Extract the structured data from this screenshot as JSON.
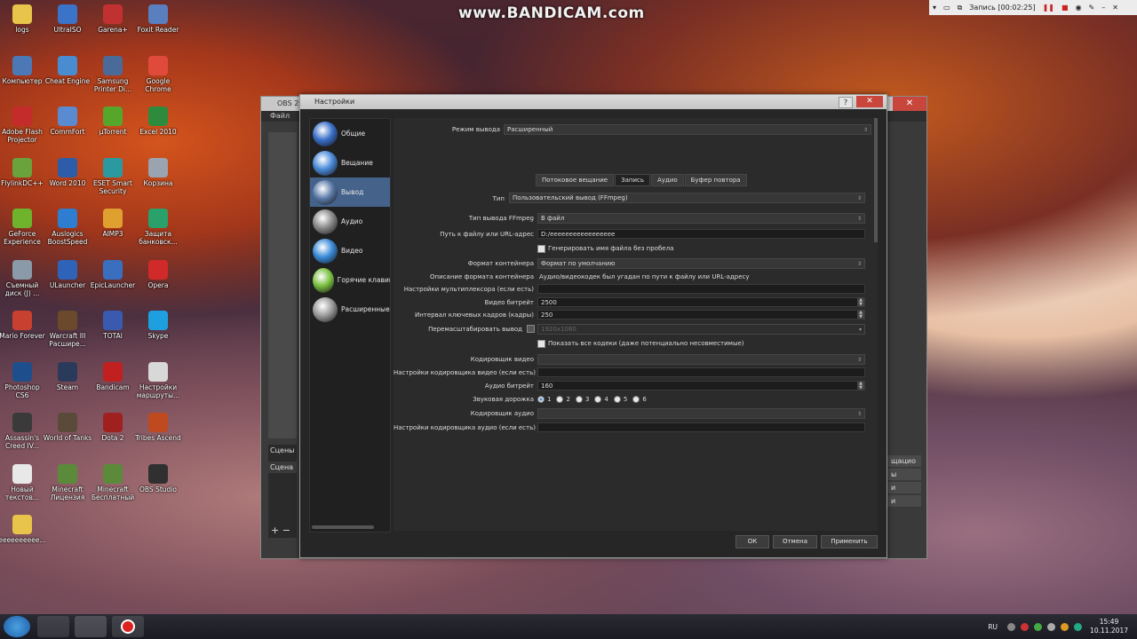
{
  "watermark": "www.BANDICAM.com",
  "recorder_bar": {
    "status": "Запись [00:02:25]"
  },
  "desktop_icons": [
    {
      "label": "logs",
      "color": "#e8c44a"
    },
    {
      "label": "UltraISO",
      "color": "#3a73c8"
    },
    {
      "label": "Garena+",
      "color": "#c23131"
    },
    {
      "label": "Foxit Reader",
      "color": "#5a7fbf"
    },
    {
      "label": "Компьютер",
      "color": "#4c79b5"
    },
    {
      "label": "Cheat Engine",
      "color": "#4a8cd0"
    },
    {
      "label": "Samsung Printer Di...",
      "color": "#4a6a9a"
    },
    {
      "label": "Google Chrome",
      "color": "#e04a3a"
    },
    {
      "label": "Adobe Flash Projector",
      "color": "#c42b2b"
    },
    {
      "label": "CommFort",
      "color": "#5a8ad0"
    },
    {
      "label": "µTorrent",
      "color": "#56a62c"
    },
    {
      "label": "Excel 2010",
      "color": "#2e8b3e"
    },
    {
      "label": "FlylinkDC++",
      "color": "#6aa23c"
    },
    {
      "label": "Word 2010",
      "color": "#2d5da8"
    },
    {
      "label": "ESET Smart Security",
      "color": "#2a9aa0"
    },
    {
      "label": "Корзина",
      "color": "#9aa4b0"
    },
    {
      "label": "GeForce Experience",
      "color": "#6fb32c"
    },
    {
      "label": "Auslogics BoostSpeed",
      "color": "#2f7dd0"
    },
    {
      "label": "AIMP3",
      "color": "#e0a030"
    },
    {
      "label": "Защита банковск...",
      "color": "#2aa06a"
    },
    {
      "label": "Съемный диск (J) ...",
      "color": "#8a9aa8"
    },
    {
      "label": "ULauncher",
      "color": "#2f63b8"
    },
    {
      "label": "EpicLauncher",
      "color": "#3a6fc0"
    },
    {
      "label": "Opera",
      "color": "#d02a2a"
    },
    {
      "label": "Mario Forever",
      "color": "#c84030"
    },
    {
      "label": "Warcraft III Расшире...",
      "color": "#6a4a2a"
    },
    {
      "label": "TOTAl",
      "color": "#3a5ab0"
    },
    {
      "label": "Skype",
      "color": "#1ea0e0"
    },
    {
      "label": "Photoshop CS6",
      "color": "#1e4f8c"
    },
    {
      "label": "Steam",
      "color": "#2a3a5a"
    },
    {
      "label": "Bandicam",
      "color": "#c02020"
    },
    {
      "label": "Настройки маршруты...",
      "color": "#d8d8d8"
    },
    {
      "label": "Assassin's Creed IV...",
      "color": "#3a3a3a"
    },
    {
      "label": "World of Tanks",
      "color": "#5a4a3a"
    },
    {
      "label": "Dota 2",
      "color": "#a02020"
    },
    {
      "label": "Tribes Ascend",
      "color": "#c04a20"
    },
    {
      "label": "Новый текстов...",
      "color": "#e8e8e8"
    },
    {
      "label": "Minecraft Лицензия",
      "color": "#5a8a3a"
    },
    {
      "label": "Minecraft Бесплатный",
      "color": "#5a8a3a"
    },
    {
      "label": "OBS Studio",
      "color": "#303030"
    },
    {
      "label": "eeeeeeeeee...",
      "color": "#e8c44a"
    }
  ],
  "obs_window": {
    "title": "OBS 20",
    "menu_file": "Файл",
    "scenes_label": "Сцены",
    "scene_item": "Сцена",
    "right_items": [
      "щацио",
      "ы",
      "и",
      "и"
    ]
  },
  "dialog": {
    "title": "Настройки",
    "help_btn": "?",
    "close_btn": "✕",
    "sidebar": [
      {
        "label": "Общие",
        "active": false,
        "color": "#3a6fc8"
      },
      {
        "label": "Вещание",
        "active": false,
        "color": "#4a8ad8"
      },
      {
        "label": "Вывод",
        "active": true,
        "color": "#5a7aa8"
      },
      {
        "label": "Аудио",
        "active": false,
        "color": "#8a8a8a"
      },
      {
        "label": "Видео",
        "active": false,
        "color": "#3a8ad8"
      },
      {
        "label": "Горячие клавиши",
        "active": false,
        "color": "#7ac040"
      },
      {
        "label": "Расширенные",
        "active": false,
        "color": "#9a9a9a"
      }
    ],
    "output_mode_label": "Режим вывода",
    "output_mode_value": "Расширенный",
    "tabs": [
      {
        "label": "Потоковое вещание",
        "active": false
      },
      {
        "label": "Запись",
        "active": true
      },
      {
        "label": "Аудио",
        "active": false
      },
      {
        "label": "Буфер повтора",
        "active": false
      }
    ],
    "type_label": "Тип",
    "type_value": "Пользовательский вывод (FFmpeg)",
    "ffmpeg_type_label": "Тип вывода FFmpeg",
    "ffmpeg_type_value": "В файл",
    "path_label": "Путь к файлу или URL-адрес",
    "path_value": "D:/eeeeeeeeeeeeeeeee",
    "gen_name_label": "Генерировать имя файла без пробела",
    "container_label": "Формат контейнера",
    "container_value": "Формат по умолчанию",
    "container_desc_label": "Описание формата контейнера",
    "container_desc_value": "Аудио/видеокодек был угадан по пути к файлу или URL-адресу",
    "mux_label": "Настройки мультиплексора (если есть)",
    "mux_value": "",
    "vbitrate_label": "Видео битрейт",
    "vbitrate_value": "2500",
    "keyint_label": "Интервал ключевых кадров (кадры)",
    "keyint_value": "250",
    "rescale_label": "Перемасштабировать вывод",
    "rescale_value": "1920x1080",
    "show_all_codecs_label": "Показать все кодеки (даже потенциально несовместимые)",
    "vencoder_label": "Кодировщик видео",
    "vencoder_value": "",
    "vencoder_settings_label": "Настройки кодировщика видео (если есть)",
    "vencoder_settings_value": "",
    "abitrate_label": "Аудио битрейт",
    "abitrate_value": "160",
    "audio_track_label": "Звуковая дорожка",
    "audio_tracks": [
      "1",
      "2",
      "3",
      "4",
      "5",
      "6"
    ],
    "aencoder_label": "Кодировщик аудио",
    "aencoder_value": "",
    "aencoder_settings_label": "Настройки кодировщика аудио (если есть)",
    "aencoder_settings_value": "",
    "ok_btn": "ОК",
    "cancel_btn": "Отмена",
    "apply_btn": "Применить"
  },
  "tray": {
    "lang": "RU",
    "time": "15:49",
    "date": "10.11.2017"
  }
}
